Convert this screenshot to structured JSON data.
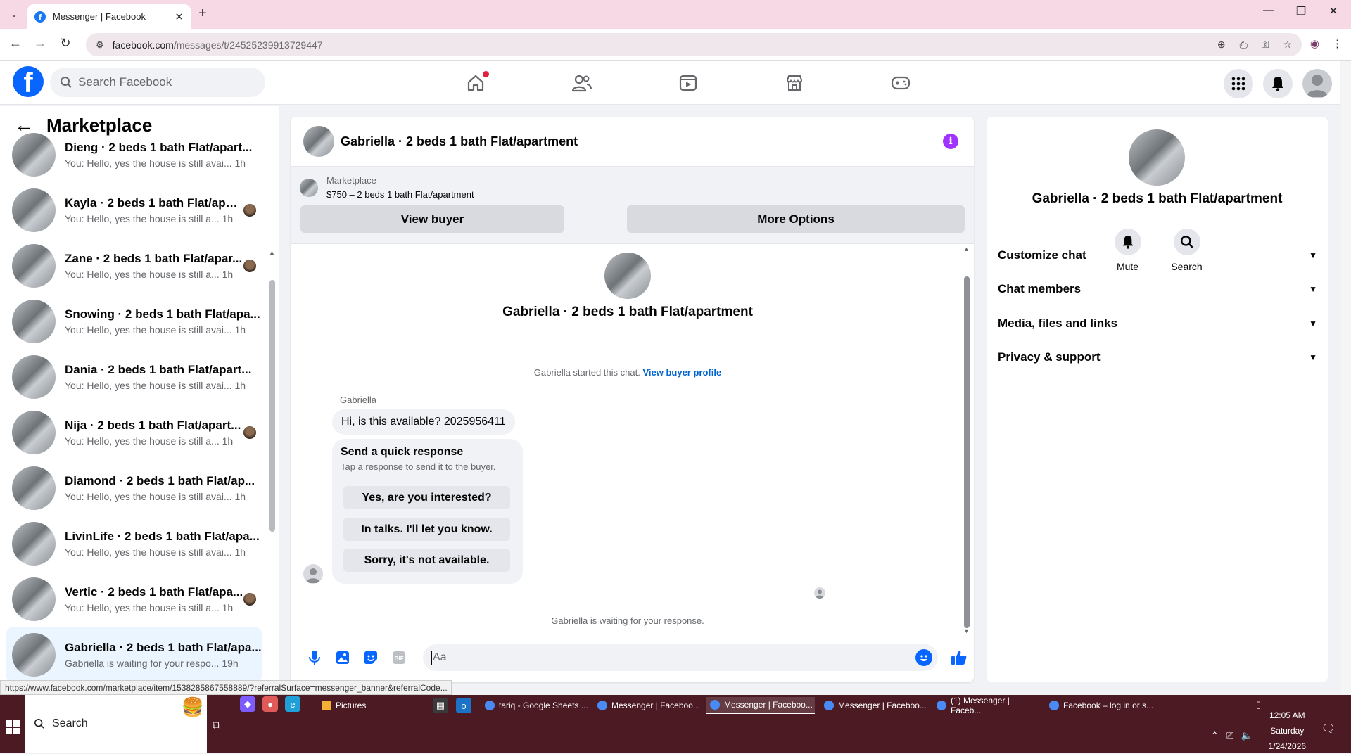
{
  "browser": {
    "tab_title": "Messenger | Facebook",
    "url_host": "facebook.com",
    "url_path": "/messages/t/24525239913729447"
  },
  "fb": {
    "search_placeholder": "Search Facebook"
  },
  "sidebar": {
    "title": "Marketplace",
    "conversations": [
      {
        "name": "Dieng · 2 beds 1 bath Flat/apart...",
        "preview": "You: Hello, yes the house is still avai...",
        "time": "1h",
        "has_avatar": false
      },
      {
        "name": "Kayla · 2 beds 1 bath Flat/apar...",
        "preview": "You: Hello, yes the house is still a...",
        "time": "1h",
        "has_avatar": true
      },
      {
        "name": "Zane · 2 beds 1 bath Flat/apar...",
        "preview": "You: Hello, yes the house is still a...",
        "time": "1h",
        "has_avatar": true
      },
      {
        "name": "Snowing · 2 beds 1 bath Flat/apa...",
        "preview": "You: Hello, yes the house is still avai...",
        "time": "1h",
        "has_avatar": false
      },
      {
        "name": "Dania · 2 beds 1 bath Flat/apart...",
        "preview": "You: Hello, yes the house is still avai...",
        "time": "1h",
        "has_avatar": false
      },
      {
        "name": "Nija · 2 beds 1 bath Flat/apart...",
        "preview": "You: Hello, yes the house is still a...",
        "time": "1h",
        "has_avatar": true
      },
      {
        "name": "Diamond · 2 beds 1 bath Flat/ap...",
        "preview": "You: Hello, yes the house is still avai...",
        "time": "1h",
        "has_avatar": false
      },
      {
        "name": "LivinLife · 2 beds 1 bath Flat/apa...",
        "preview": "You: Hello, yes the house is still avai...",
        "time": "1h",
        "has_avatar": false
      },
      {
        "name": "Vertic · 2 beds 1 bath Flat/apa...",
        "preview": "You: Hello, yes the house is still a...",
        "time": "1h",
        "has_avatar": true
      },
      {
        "name": "Gabriella · 2 beds 1 bath Flat/apa...",
        "preview": "Gabriella is waiting for your respo...",
        "time": "19h",
        "has_avatar": false,
        "active": true
      }
    ]
  },
  "chat": {
    "title": "Gabriella · 2 beds 1 bath Flat/apartment",
    "marketplace_label": "Marketplace",
    "listing": "$750 – 2 beds 1 bath Flat/apartment",
    "view_buyer": "View buyer",
    "more_options": "More Options",
    "started_text": "Gabriella started this chat.",
    "view_buyer_profile": "View buyer profile",
    "sender": "Gabriella",
    "message": "Hi, is this available? 2025956411",
    "quick_title": "Send a quick response",
    "quick_sub": "Tap a response to send it to the buyer.",
    "quick_options": [
      "Yes, are you interested?",
      "In talks. I'll let you know.",
      "Sorry, it's not available."
    ],
    "waiting": "Gabriella is waiting for your response.",
    "composer_placeholder": "Aa"
  },
  "info_panel": {
    "name": "Gabriella · 2 beds 1 bath Flat/apartment",
    "mute": "Mute",
    "search": "Search",
    "sections": [
      "Customize chat",
      "Chat members",
      "Media, files and links",
      "Privacy & support"
    ]
  },
  "status_url": "https://www.facebook.com/marketplace/item/1538285867558889/?referralSurface=messenger_banner&referralCode...",
  "taskbar": {
    "search": "Search",
    "apps": [
      {
        "label": "Pictures",
        "color": "#f2b134"
      },
      {
        "label": "tariq - Google Sheets ...",
        "color": "#4a8af4"
      },
      {
        "label": "Messenger | Faceboo...",
        "color": "#4a8af4"
      },
      {
        "label": "Messenger | Faceboo...",
        "color": "#4a8af4",
        "active": true
      },
      {
        "label": "Messenger | Faceboo...",
        "color": "#4a8af4"
      },
      {
        "label": "(1) Messenger | Faceb...",
        "color": "#4a8af4"
      },
      {
        "label": "Facebook – log in or s...",
        "color": "#4a8af4"
      }
    ],
    "time": "12:05 AM",
    "day": "Saturday",
    "date": "1/24/2026"
  }
}
